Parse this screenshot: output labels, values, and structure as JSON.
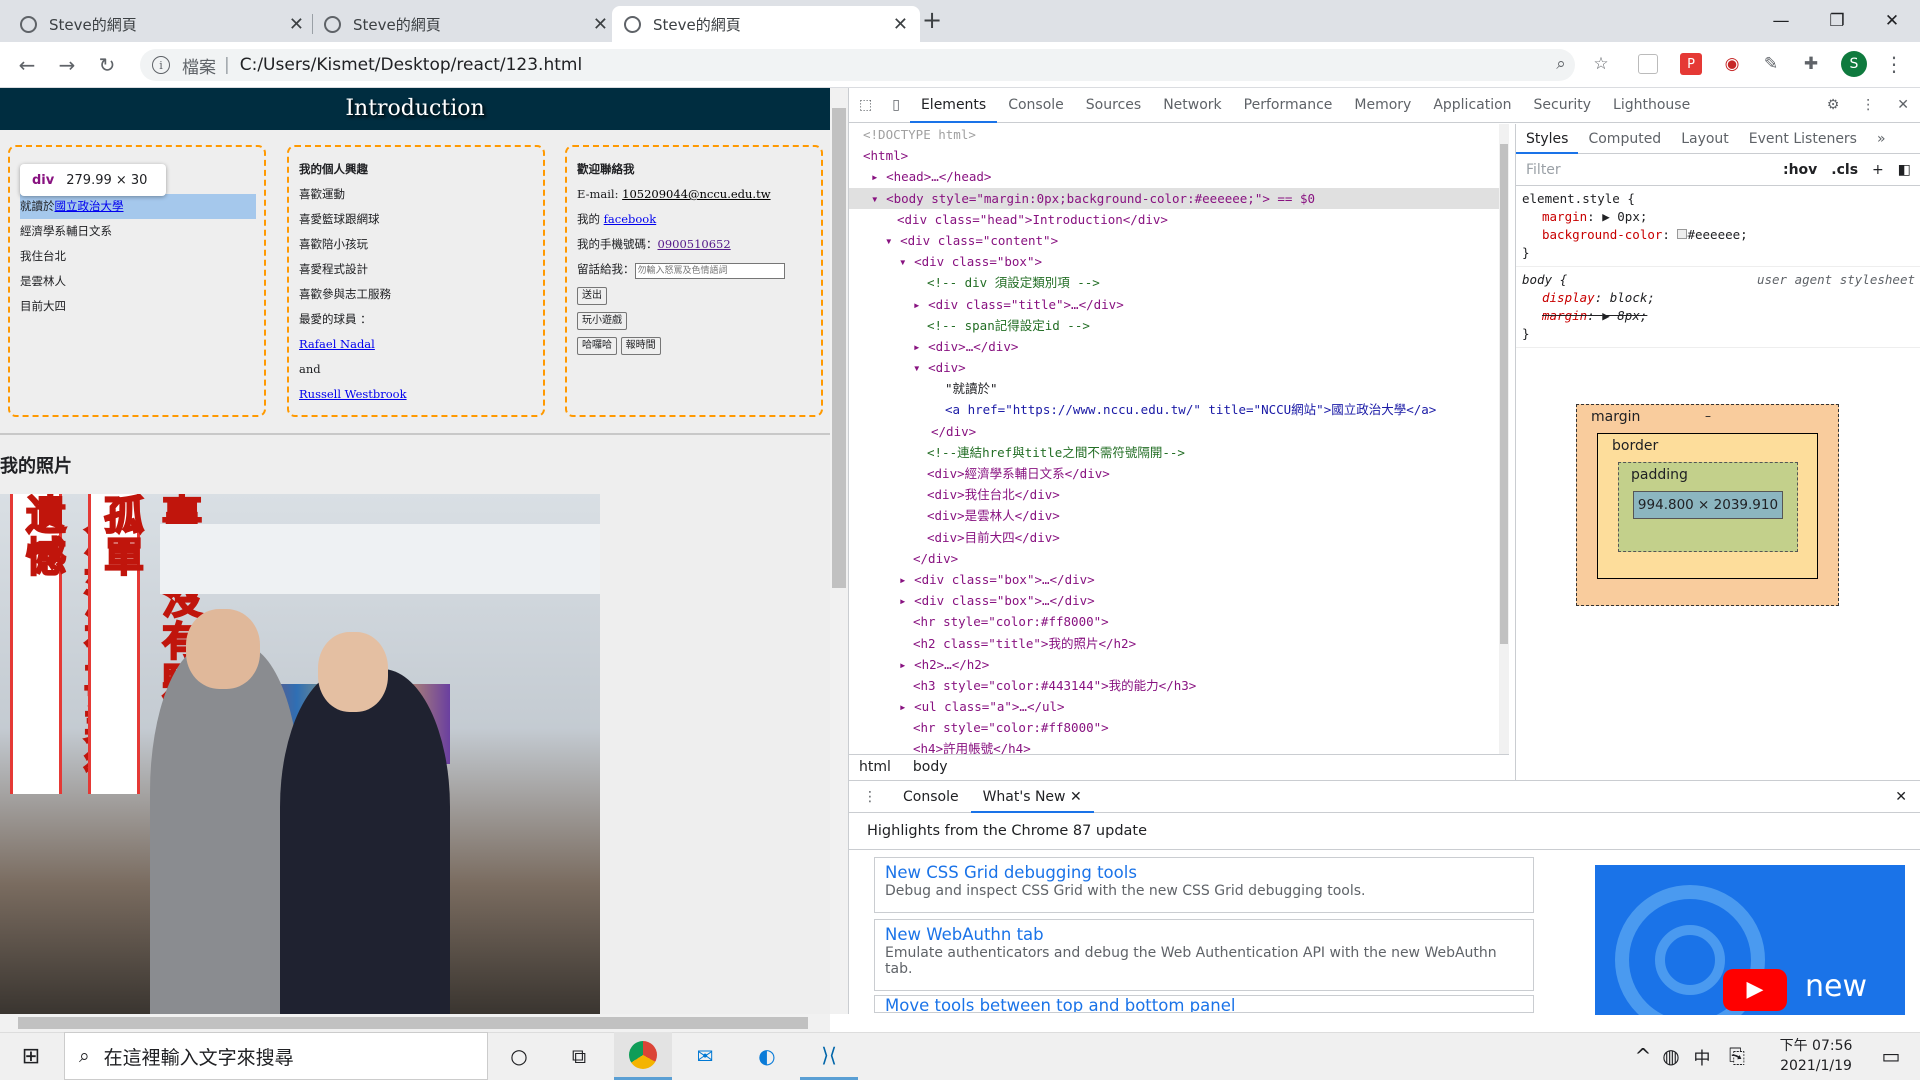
{
  "browser": {
    "tabs": [
      {
        "title": "Steve的網頁"
      },
      {
        "title": "Steve的網頁"
      },
      {
        "title": "Steve的網頁"
      }
    ],
    "address": {
      "scheme": "檔案",
      "separator": "|",
      "url": "C:/Users/Kismet/Desktop/react/123.html"
    },
    "profile_initial": "S"
  },
  "page": {
    "header": "Introduction",
    "inspect_tooltip": {
      "tag": "div",
      "size": "279.99 × 30"
    },
    "box1": {
      "lines": [
        "就讀於",
        "經濟學系輔日文系",
        "我住台北",
        "是雲林人",
        "目前大四"
      ],
      "link": "國立政治大學"
    },
    "box2": {
      "title": "我的個人興趣",
      "lines": [
        "喜歡運動",
        "喜愛籃球跟網球",
        "喜歡陪小孩玩",
        "喜愛程式設計",
        "喜歡參與志工服務",
        "最愛的球員 ："
      ],
      "player1": "Rafael Nadal",
      "and": "and",
      "player2": "Russell Westbrook"
    },
    "box3": {
      "title": "歡迎聯絡我",
      "email_label": "E-mail:",
      "email": "105209044@nccu.edu.tw",
      "my_label": "我的",
      "facebook": "facebook",
      "phone_label": "我的手機號碼：",
      "phone": "0900510652",
      "message_label": "留話給我：",
      "message_placeholder": "勿輸入怒罵及色情語詞",
      "submit": "送出",
      "game": "玩小遊戲",
      "hello": "哈囉哈",
      "time": "報時間"
    },
    "photo_heading": "我的照片",
    "photo_banner_right": "事業沒有夥伴很孤單",
    "photo_banner_left": "人生沒有事業很遺憾"
  },
  "devtools": {
    "tabs": [
      "Elements",
      "Console",
      "Sources",
      "Network",
      "Performance",
      "Memory",
      "Application",
      "Security",
      "Lighthouse"
    ],
    "active_tab": "Elements",
    "elements": [
      "<!DOCTYPE html>",
      "<html>",
      "<head>…</head>",
      "<body style=\"margin:0px;background-color:#eeeeee;\"> == $0",
      "<div class=\"head\">Introduction</div>",
      "<div class=\"content\">",
      "<div class=\"box\">",
      "<!-- div 須設定類別項 -->",
      "<div class=\"title\">…</div>",
      "<!-- span記得設定id -->",
      "<div>…</div>",
      "<div>",
      "\"就讀於\"",
      "<a href=\"https://www.nccu.edu.tw/\" title=\"NCCU網站\">國立政治大學</a>",
      "</div>",
      "<!--連結href與title之間不需符號隔開-->",
      "<div>經濟學系輔日文系</div>",
      "<div>我住台北</div>",
      "<div>是雲林人</div>",
      "<div>目前大四</div>",
      "</div>",
      "<div class=\"box\">…</div>",
      "<div class=\"box\">…</div>",
      "<hr style=\"color:#ff8000\">",
      "<h2 class=\"title\">我的照片</h2>",
      "<h2>…</h2>",
      "<h3 style=\"color:#443144\">我的能力</h3>",
      "<ul class=\"a\">…</ul>",
      "<hr style=\"color:#ff8000\">",
      "<h4>許用帳號</h4>"
    ],
    "breadcrumb": [
      "html",
      "body"
    ],
    "side_tabs": [
      "Styles",
      "Computed",
      "Layout",
      "Event Listeners"
    ],
    "filter_placeholder": "Filter",
    "hov": ":hov",
    "cls": ".cls",
    "element_style": {
      "selector": "element.style {",
      "props": [
        {
          "name": "margin",
          "value": "▶ 0px;"
        },
        {
          "name": "background-color",
          "value": "#eeeeee;"
        }
      ]
    },
    "ua_rule": {
      "selector": "body {",
      "source": "user agent stylesheet",
      "props": [
        {
          "name": "display",
          "value": "block;"
        },
        {
          "name": "margin",
          "value": "▶ 8px;"
        }
      ]
    },
    "box_model": {
      "margin": "margin",
      "border": "border",
      "padding": "padding",
      "content": "994.800 × 2039.910",
      "dash": "–"
    },
    "drawer": {
      "tabs": [
        "Console",
        "What's New"
      ],
      "highlight": "Highlights from the Chrome 87 update",
      "items": [
        {
          "title": "New CSS Grid debugging tools",
          "desc": "Debug and inspect CSS Grid with the new CSS Grid debugging tools."
        },
        {
          "title": "New WebAuthn tab",
          "desc": "Emulate authenticators and debug the Web Authentication API with the new WebAuthn tab."
        },
        {
          "title": "Move tools between top and bottom panel",
          "desc": ""
        }
      ],
      "video_label": "new"
    }
  },
  "taskbar": {
    "search_placeholder": "在這裡輸入文字來搜尋",
    "ime": "中",
    "time": "下午 07:56",
    "date": "2021/1/19"
  }
}
